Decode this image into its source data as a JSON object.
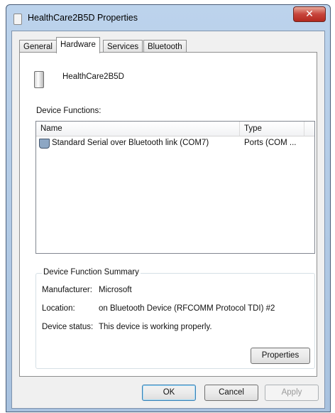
{
  "window": {
    "title": "HealthCare2B5D Properties",
    "close_glyph": "✕"
  },
  "tabs": [
    {
      "label": "General",
      "active": false
    },
    {
      "label": "Hardware",
      "active": true
    },
    {
      "label": "Services",
      "active": false
    },
    {
      "label": "Bluetooth",
      "active": false
    }
  ],
  "device": {
    "icon": "device-icon",
    "name": "HealthCare2B5D"
  },
  "device_functions": {
    "label": "Device Functions:",
    "columns": {
      "name": "Name",
      "type": "Type"
    },
    "rows": [
      {
        "icon": "port-icon",
        "name": "Standard Serial over Bluetooth link (COM7)",
        "type": "Ports (COM ..."
      }
    ]
  },
  "summary": {
    "title": "Device Function Summary",
    "manufacturer_label": "Manufacturer:",
    "manufacturer_value": "Microsoft",
    "location_label": "Location:",
    "location_value": "on Bluetooth Device (RFCOMM Protocol TDI) #2",
    "status_label": "Device status:",
    "status_value": "This device is working properly.",
    "properties_button": "Properties"
  },
  "buttons": {
    "ok": "OK",
    "cancel": "Cancel",
    "apply": "Apply"
  },
  "colors": {
    "titlebar": "#bcd3ec",
    "close_button": "#c7443b",
    "dialog_background": "#f0f0f0"
  }
}
